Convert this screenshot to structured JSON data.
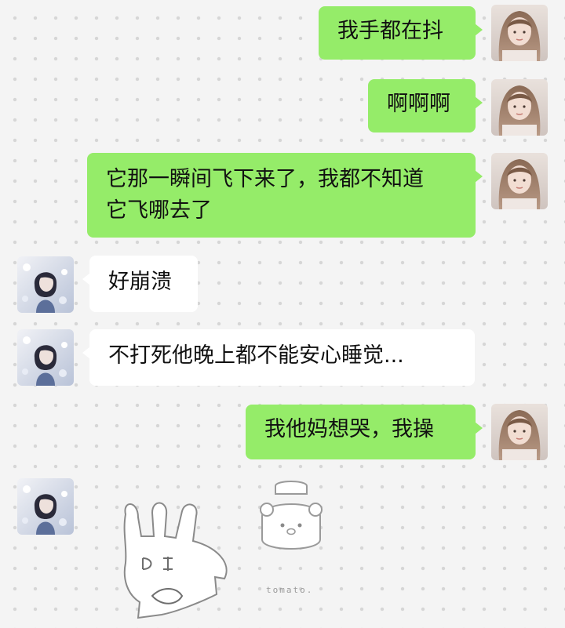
{
  "chat": {
    "messages": [
      {
        "sender": "me",
        "lines": [
          "我手都在抖"
        ]
      },
      {
        "sender": "me",
        "lines": [
          "啊啊啊"
        ]
      },
      {
        "sender": "me",
        "lines": [
          "它那一瞬间飞下来了，我都不知道",
          "它飞哪去了"
        ]
      },
      {
        "sender": "other",
        "lines": [
          "好崩溃"
        ]
      },
      {
        "sender": "other",
        "lines": [
          "不打死他晚上都不能安心睡觉..."
        ]
      },
      {
        "sender": "me",
        "lines": [
          "我他妈想哭，我操"
        ]
      },
      {
        "sender": "other",
        "sticker": "rabbit-bear-sticker",
        "caption": "tomato."
      }
    ]
  },
  "colors": {
    "my_bubble": "#95ec69",
    "other_bubble": "#ffffff",
    "background": "#f4f4f4",
    "dots": "#d6d6d6"
  },
  "icons": {
    "my_avatar": "girl-photo-avatar",
    "other_avatar": "anime-character-avatar",
    "sticker": "rabbit-and-bear-doodle"
  }
}
